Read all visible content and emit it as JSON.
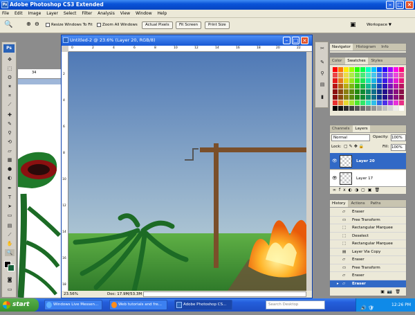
{
  "window": {
    "title": "Adobe Photoshop CS3 Extended",
    "app_icon": "Ps"
  },
  "menu": [
    "File",
    "Edit",
    "Image",
    "Layer",
    "Select",
    "Filter",
    "Analysis",
    "View",
    "Window",
    "Help"
  ],
  "options": {
    "resize_windows": "Resize Windows To Fit",
    "zoom_all": "Zoom All Windows",
    "actual_pixels": "Actual Pixels",
    "fit_screen": "Fit Screen",
    "print_size": "Print Size",
    "workspace": "Workspace ▼"
  },
  "toolbox": {
    "logo": "Ps"
  },
  "document": {
    "title": "Untitled-2 @ 23.6% (Layer 20, RGB/8)",
    "zoom": "23.56%",
    "doc_size": "Doc: 17.9M/53.3M",
    "ruler_top": [
      "0",
      "2",
      "4",
      "6",
      "8",
      "10",
      "12",
      "14",
      "16",
      "18",
      "20",
      "22"
    ],
    "ruler_left": [
      "2",
      "4",
      "6",
      "8",
      "10",
      "12",
      "14",
      "16",
      "18"
    ],
    "bg_ruler_value": "34"
  },
  "navigator_panel": {
    "tabs": [
      "Navigator",
      "Histogram",
      "Info"
    ]
  },
  "swatches_panel": {
    "tabs": [
      "Color",
      "Swatches",
      "Styles"
    ]
  },
  "layers_panel": {
    "tabs": [
      "Channels",
      "Layers"
    ],
    "blend_mode": "Normal",
    "opacity_label": "Opacity:",
    "opacity_value": "100%",
    "lock_label": "Lock:",
    "fill_label": "Fill:",
    "fill_value": "100%",
    "layers": [
      {
        "name": "Layer 20",
        "selected": true
      },
      {
        "name": "Layer 17",
        "selected": false
      }
    ]
  },
  "history_panel": {
    "tabs": [
      "History",
      "Actions",
      "Paths"
    ],
    "items": [
      {
        "label": "Eraser",
        "selected": false
      },
      {
        "label": "Free Transform",
        "selected": false
      },
      {
        "label": "Rectangular Marquee",
        "selected": false
      },
      {
        "label": "Deselect",
        "selected": false
      },
      {
        "label": "Rectangular Marquee",
        "selected": false
      },
      {
        "label": "Layer Via Copy",
        "selected": false
      },
      {
        "label": "Eraser",
        "selected": false
      },
      {
        "label": "Free Transform",
        "selected": false
      },
      {
        "label": "Eraser",
        "selected": false
      },
      {
        "label": "Eraser",
        "selected": true
      }
    ]
  },
  "taskbar": {
    "start": "start",
    "tasks": [
      {
        "label": "Windows Live Messen...",
        "active": false
      },
      {
        "label": "Web tutorials and fre...",
        "active": false
      },
      {
        "label": "Adobe Photoshop CS...",
        "active": true
      }
    ],
    "search_placeholder": "Search Desktop",
    "clock": "12:26 PM"
  },
  "colors": {
    "titlebar": "#0a53d8",
    "selection": "#3169c6",
    "sky_top": "#4f79b6",
    "grass": "#4f9a3b",
    "fire": "#ff9a1a"
  }
}
